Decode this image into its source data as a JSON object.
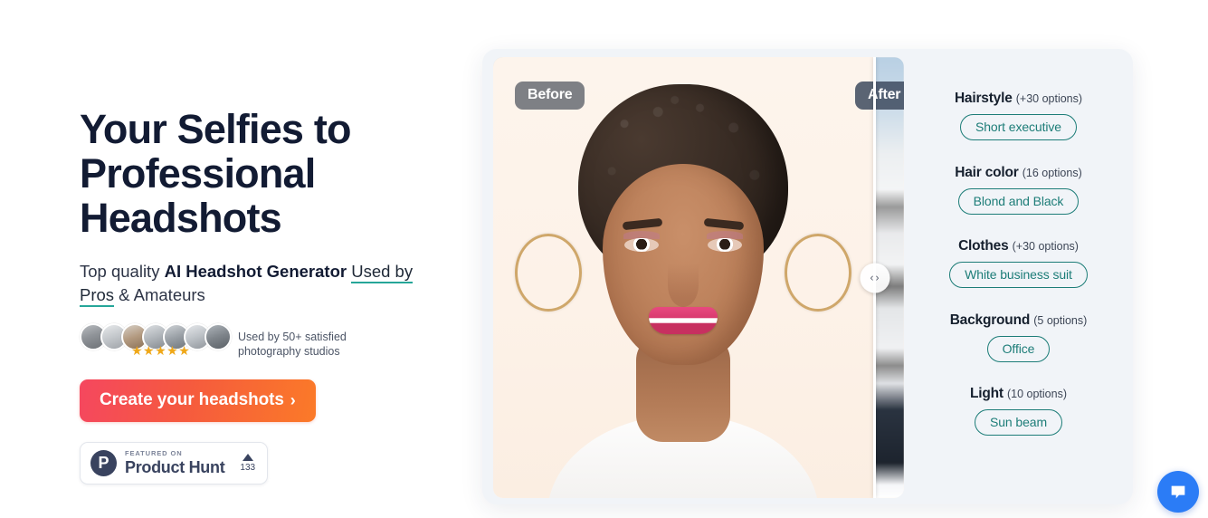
{
  "hero": {
    "headline": "Your Selfies to Professional Headshots",
    "subtitle_lead": "Top quality ",
    "subtitle_bold": "AI Headshot Generator",
    "subtitle_link": "Used by Pros",
    "subtitle_tail": " & Amateurs",
    "social_proof_line1": "Used by 50+ satisfied",
    "social_proof_line2": "photography studios",
    "stars": "★★★★★",
    "cta_label": "Create your headshots",
    "cta_chevron": "›"
  },
  "product_hunt": {
    "logo_letter": "P",
    "featured_on": "FEATURED ON",
    "name": "Product Hunt",
    "upvotes": "133"
  },
  "compare": {
    "before_label": "Before",
    "after_label": "After",
    "prev_arrow": "‹",
    "next_arrow": "›"
  },
  "options": [
    {
      "label": "Hairstyle",
      "count": "(+30 options)",
      "chip": "Short executive"
    },
    {
      "label": "Hair color",
      "count": "(16 options)",
      "chip": "Blond and Black"
    },
    {
      "label": "Clothes",
      "count": "(+30 options)",
      "chip": "White business suit"
    },
    {
      "label": "Background",
      "count": "(5 options)",
      "chip": "Office"
    },
    {
      "label": "Light",
      "count": "(10 options)",
      "chip": "Sun beam"
    }
  ],
  "chat": {
    "icon": "chat-bubble-icon"
  },
  "colors": {
    "accent_teal": "#1d7d78",
    "cta_gradient_start": "#f5475f",
    "cta_gradient_end": "#fb7a28",
    "headline": "#121b33",
    "card_bg": "#f1f4f8",
    "chat_blue": "#2b7cf6",
    "star_gold": "#f0a818",
    "ph_navy": "#39435f"
  }
}
